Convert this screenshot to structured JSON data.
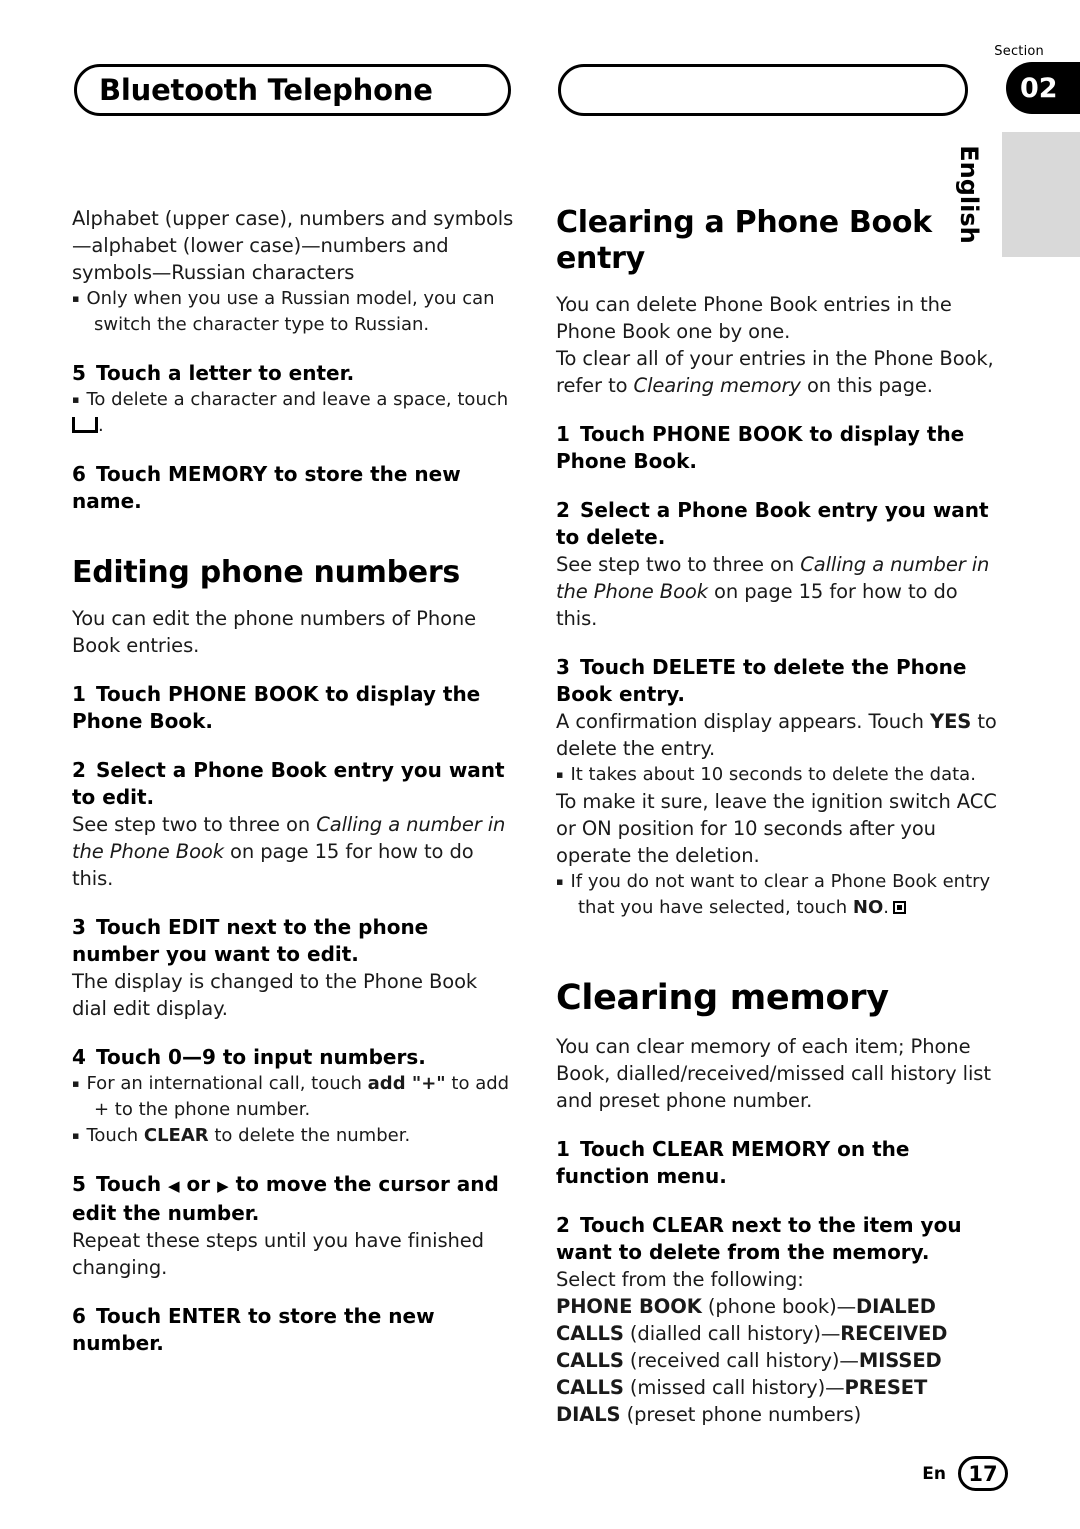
{
  "header": {
    "title": "Bluetooth Telephone",
    "section_label": "Section",
    "section_number": "02",
    "language_tab": "English"
  },
  "left_column": {
    "intro_p1": "Alphabet (upper case), numbers and symbols—alphabet (lower case)—numbers and symbols—Russian characters",
    "intro_bullet": "Only when you use a Russian model, you can switch the character type to Russian.",
    "step5_num": "5",
    "step5_text": "Touch a letter to enter.",
    "step5_bullet": "To delete a character and leave a space, touch",
    "step6_num": "6",
    "step6_text": "Touch MEMORY to store the new name.",
    "heading_editing": "Editing phone numbers",
    "editing_intro": "You can edit the phone numbers of Phone Book entries.",
    "e_step1_num": "1",
    "e_step1_text": "Touch PHONE BOOK to display the Phone Book.",
    "e_step2_num": "2",
    "e_step2_text": "Select a Phone Book entry you want to edit.",
    "e_step2_note_a": "See step two to three on ",
    "e_step2_note_i": "Calling a number in the Phone Book",
    "e_step2_note_b": " on page 15 for how to do this.",
    "e_step3_num": "3",
    "e_step3_text": "Touch EDIT next to the phone number you want to edit.",
    "e_step3_note": "The display is changed to the Phone Book dial edit display.",
    "e_step4_num": "4",
    "e_step4_text": "Touch 0—9 to input numbers.",
    "e_step4_bullet1_a": "For an international call, touch ",
    "e_step4_bullet1_b": "add \"+\"",
    "e_step4_bullet1_c": " to add + to the phone number.",
    "e_step4_bullet2_a": "Touch ",
    "e_step4_bullet2_b": "CLEAR",
    "e_step4_bullet2_c": " to delete the number.",
    "e_step5_num": "5",
    "e_step5_text_a": "Touch ",
    "e_step5_text_b": " or ",
    "e_step5_text_c": " to move the cursor and edit the number.",
    "e_step5_note": "Repeat these steps until you have finished changing.",
    "e_step6_num": "6",
    "e_step6_text": "Touch ENTER to store the new number."
  },
  "right_column": {
    "heading_clearing_entry": "Clearing a Phone Book entry",
    "c_intro1": "You can delete Phone Book entries in the Phone Book one by one.",
    "c_intro2_a": "To clear all of your entries in the Phone Book, refer to ",
    "c_intro2_i": "Clearing memory",
    "c_intro2_b": " on this page.",
    "c_step1_num": "1",
    "c_step1_text": "Touch PHONE BOOK to display the Phone Book.",
    "c_step2_num": "2",
    "c_step2_text": "Select a Phone Book entry you want to delete.",
    "c_step2_note_a": "See step two to three on ",
    "c_step2_note_i": "Calling a number in the Phone Book",
    "c_step2_note_b": " on page 15 for how to do this.",
    "c_step3_num": "3",
    "c_step3_text": "Touch DELETE to delete the Phone Book entry.",
    "c_step3_note_a": "A confirmation display appears. Touch ",
    "c_step3_note_b": "YES",
    "c_step3_note_c": " to delete the entry.",
    "c_bullet1": "It takes about 10 seconds to delete the data.",
    "c_after_bullet1": "To make it sure, leave the ignition switch ACC or ON position for 10 seconds after you operate the deletion.",
    "c_bullet2_a": "If you do not want to clear a Phone Book entry that you have selected, touch ",
    "c_bullet2_b": "NO",
    "c_bullet2_c": ".",
    "heading_clearing_memory": "Clearing memory",
    "m_intro": "You can clear memory of each item; Phone Book, dialled/received/missed call history list and preset phone number.",
    "m_step1_num": "1",
    "m_step1_text": "Touch CLEAR MEMORY on the function menu.",
    "m_step2_num": "2",
    "m_step2_text": "Touch CLEAR next to the item you want to delete from the memory.",
    "m_step2_note": "Select from the following:",
    "m_list": {
      "i1_b": "PHONE BOOK",
      "i1_n": " (phone book)—",
      "i2_b": "DIALED CALLS",
      "i2_n": " (dialled call history)—",
      "i3_b": "RECEIVED CALLS",
      "i3_n": " (received call history)—",
      "i4_b": "MISSED CALLS",
      "i4_n": " (missed call history)—",
      "i5_b": "PRESET DIALS",
      "i5_n": " (preset phone numbers)"
    }
  },
  "footer": {
    "lang": "En",
    "page": "17"
  }
}
